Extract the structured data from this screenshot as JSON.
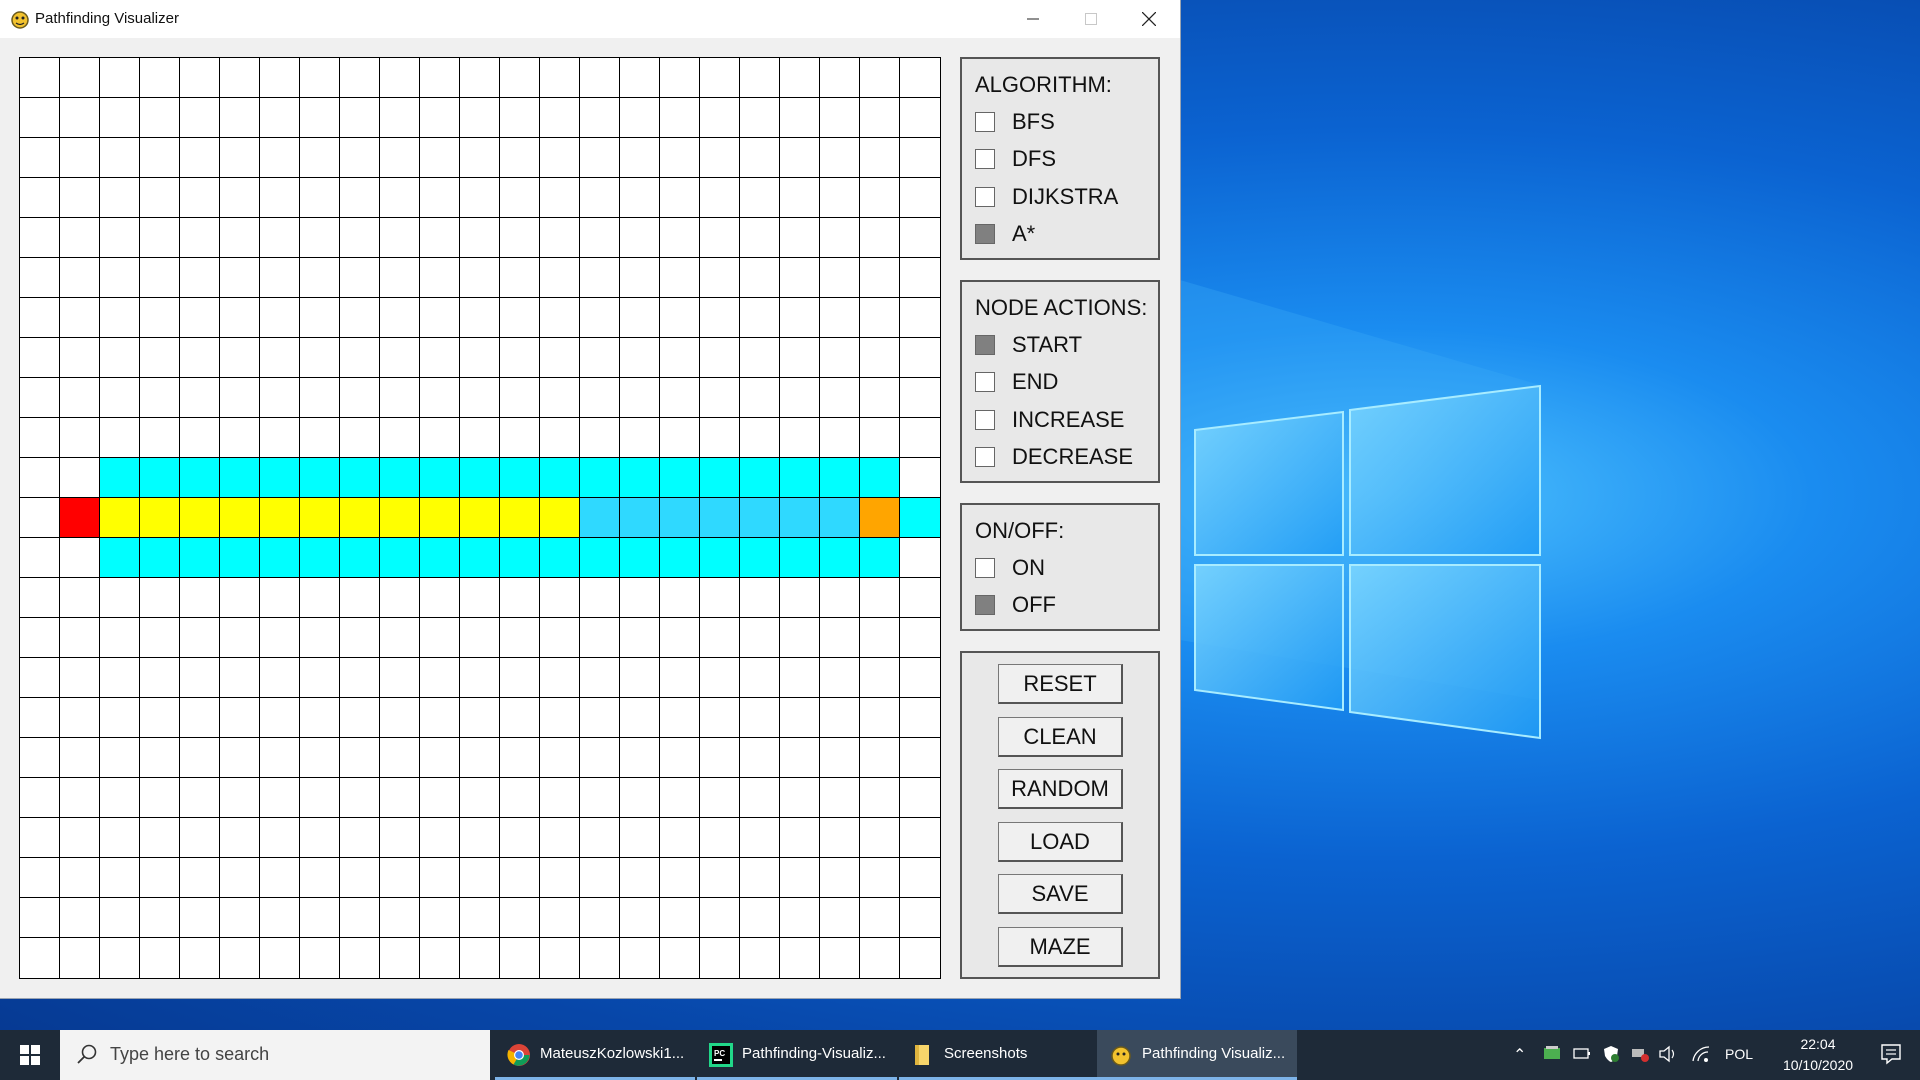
{
  "window": {
    "title": "Pathfinding Visualizer"
  },
  "grid": {
    "cols": 23,
    "rows": 23,
    "colors": {
      "empty": "#ffffff",
      "start": "#ff0000",
      "end": "#ffa500",
      "visited": "#00ffff",
      "open": "#2fd9ff",
      "path": "#ffff00"
    },
    "start": [
      11,
      1
    ],
    "end": [
      11,
      21
    ],
    "visited_rows": [
      10,
      12
    ],
    "visited_cols_range": [
      2,
      21
    ],
    "path_row": 11,
    "path_cols_range": [
      2,
      13
    ],
    "open_cols_range": [
      14,
      20
    ],
    "extra_visited": [
      [
        11,
        22
      ]
    ]
  },
  "panels": {
    "algorithm": {
      "title": "ALGORITHM:",
      "options": [
        {
          "label": "BFS",
          "checked": false
        },
        {
          "label": "DFS",
          "checked": false
        },
        {
          "label": "DIJKSTRA",
          "checked": false
        },
        {
          "label": "A*",
          "checked": true
        }
      ]
    },
    "node_actions": {
      "title": "NODE ACTIONS:",
      "options": [
        {
          "label": "START",
          "checked": true
        },
        {
          "label": "END",
          "checked": false
        },
        {
          "label": "INCREASE",
          "checked": false
        },
        {
          "label": "DECREASE",
          "checked": false
        }
      ]
    },
    "onoff": {
      "title": "ON/OFF:",
      "options": [
        {
          "label": "ON",
          "checked": false
        },
        {
          "label": "OFF",
          "checked": true
        }
      ]
    },
    "buttons": [
      "RESET",
      "CLEAN",
      "RANDOM",
      "LOAD",
      "SAVE",
      "MAZE"
    ]
  },
  "taskbar": {
    "search_placeholder": "Type here to search",
    "tasks": [
      {
        "label": "MateuszKozlowski1...",
        "icon": "chrome-icon",
        "active": false
      },
      {
        "label": "Pathfinding-Visualiz...",
        "icon": "pycharm-icon",
        "active": false
      },
      {
        "label": "Screenshots",
        "icon": "folder-icon",
        "active": false
      },
      {
        "label": "Pathfinding Visualiz...",
        "icon": "pygame-icon",
        "active": true
      }
    ],
    "language": "POL",
    "time": "22:04",
    "date": "10/10/2020"
  }
}
